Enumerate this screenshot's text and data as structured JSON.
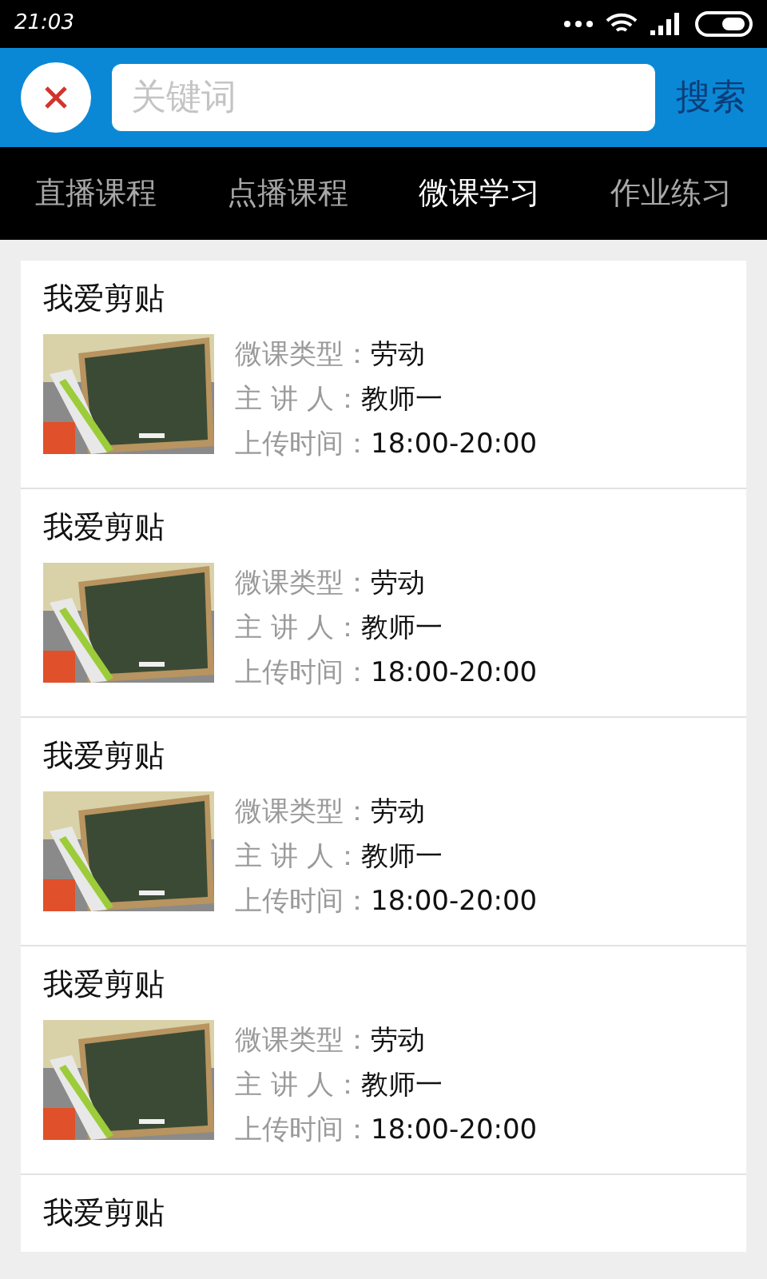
{
  "status_bar": {
    "time": "21:03"
  },
  "search": {
    "placeholder": "关键词",
    "button": "搜索"
  },
  "tabs": [
    {
      "label": "直播课程",
      "selected": false
    },
    {
      "label": "点播课程",
      "selected": false
    },
    {
      "label": "微课学习",
      "selected": true
    },
    {
      "label": "作业练习",
      "selected": false
    }
  ],
  "items": [
    {
      "title": "我爱剪贴",
      "thumbnail": {
        "kind": "picture"
      },
      "fields": [
        {
          "label": "微课类型：",
          "value": "劳动"
        },
        {
          "label": "主 讲 人：",
          "value": "教师一"
        },
        {
          "label": "上传时间：",
          "value": "18:00-20:00"
        }
      ]
    },
    {
      "title": "我爱剪贴",
      "thumbnail": {
        "kind": "picture"
      },
      "fields": [
        {
          "label": "微课类型：",
          "value": "劳动"
        },
        {
          "label": "主 讲 人：",
          "value": "教师一"
        },
        {
          "label": "上传时间：",
          "value": "18:00-20:00"
        }
      ]
    },
    {
      "title": "我爱剪贴",
      "thumbnail": {
        "kind": "picture"
      },
      "fields": [
        {
          "label": "微课类型：",
          "value": "劳动"
        },
        {
          "label": "主 讲 人：",
          "value": "教师一"
        },
        {
          "label": "上传时间：",
          "value": "18:00-20:00"
        }
      ]
    },
    {
      "title": "我爱剪贴",
      "thumbnail": {
        "kind": "picture"
      },
      "fields": [
        {
          "label": "微课类型：",
          "value": "劳动"
        },
        {
          "label": "主 讲 人：",
          "value": "教师一"
        },
        {
          "label": "上传时间：",
          "value": "18:00-20:00"
        }
      ]
    },
    {
      "title": "我爱剪贴"
    }
  ]
}
